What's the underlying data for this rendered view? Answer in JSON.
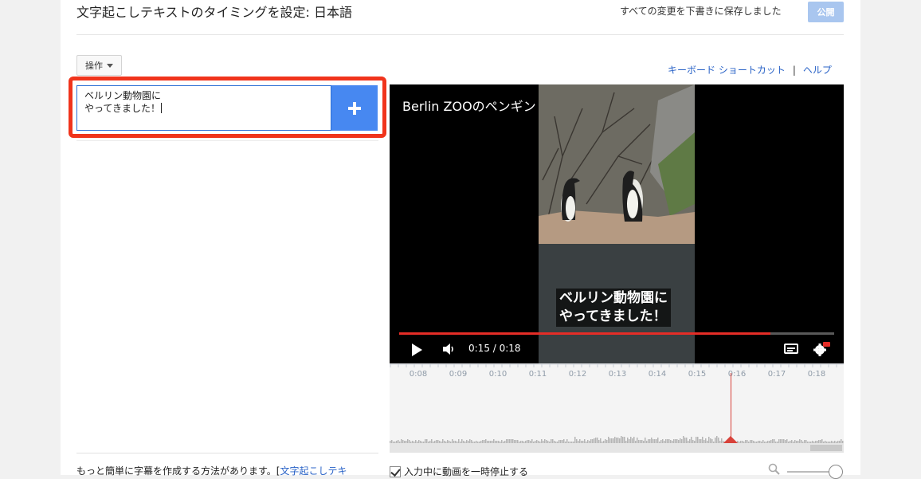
{
  "header": {
    "title": "文字起こしテキストのタイミングを設定: 日本語",
    "save_status": "すべての変更を下書きに保存しました",
    "publish_label": "公開"
  },
  "toolbar": {
    "actions_label": "操作"
  },
  "links": {
    "keyboard_shortcuts": "キーボード ショートカット",
    "separator": "|",
    "help": "ヘルプ"
  },
  "editor": {
    "caption_text": "ベルリン動物園に\nやってきました！"
  },
  "video": {
    "title": "Berlin ZOOのペンギン",
    "subtitle": "ベルリン動物園に\nやってきました！",
    "time": "0:15 / 0:18",
    "progress": 0.853
  },
  "timeline": {
    "ticks": [
      "0:08",
      "0:09",
      "0:10",
      "0:11",
      "0:12",
      "0:13",
      "0:14",
      "0:15",
      "0:16",
      "0:17",
      "0:18"
    ]
  },
  "options": {
    "pause_while_typing": "入力中に動画を一時停止する"
  },
  "footer": {
    "hint_text": "もっと簡単に字幕を作成する方法があります。[",
    "hint_link": "文字起こしテキ"
  }
}
